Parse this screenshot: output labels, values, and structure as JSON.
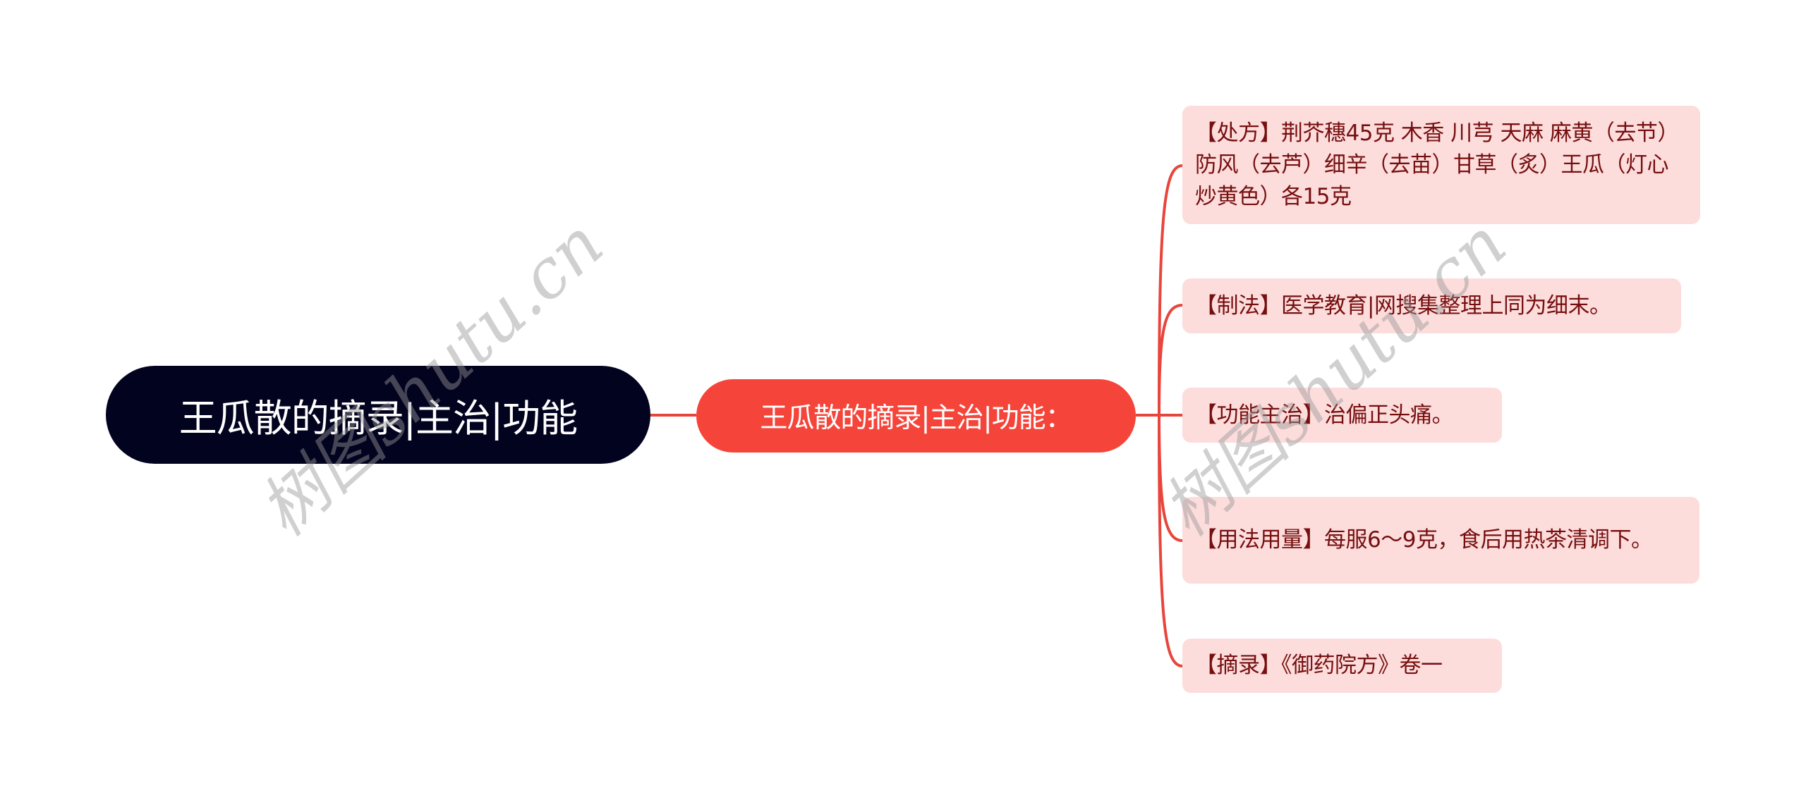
{
  "colors": {
    "root_bg": "#02031f",
    "mid_bg": "#f5453a",
    "connector": "#e8453c",
    "leaf_bg": "#fddcdc",
    "leaf_text": "#760f0f",
    "watermark": "#969696"
  },
  "root": {
    "label": "王瓜散的摘录|主治|功能"
  },
  "branch": {
    "label": "王瓜散的摘录|主治|功能："
  },
  "leaves": [
    {
      "label": "【处方】荆芥穗45克 木香 川芎 天麻 麻黄（去节）防风（去芦）细辛（去苗）甘草（炙）王瓜（灯心炒黄色）各15克"
    },
    {
      "label": "【制法】医学教育|网搜集整理上同为细末。"
    },
    {
      "label": "【功能主治】治偏正头痛。"
    },
    {
      "label": "【用法用量】每服6～9克，食后用热茶清调下。"
    },
    {
      "label": "【摘录】《御药院方》卷一"
    }
  ],
  "watermarks": [
    {
      "text": "树图shutu.cn"
    },
    {
      "text": "树图shutu.cn"
    }
  ]
}
